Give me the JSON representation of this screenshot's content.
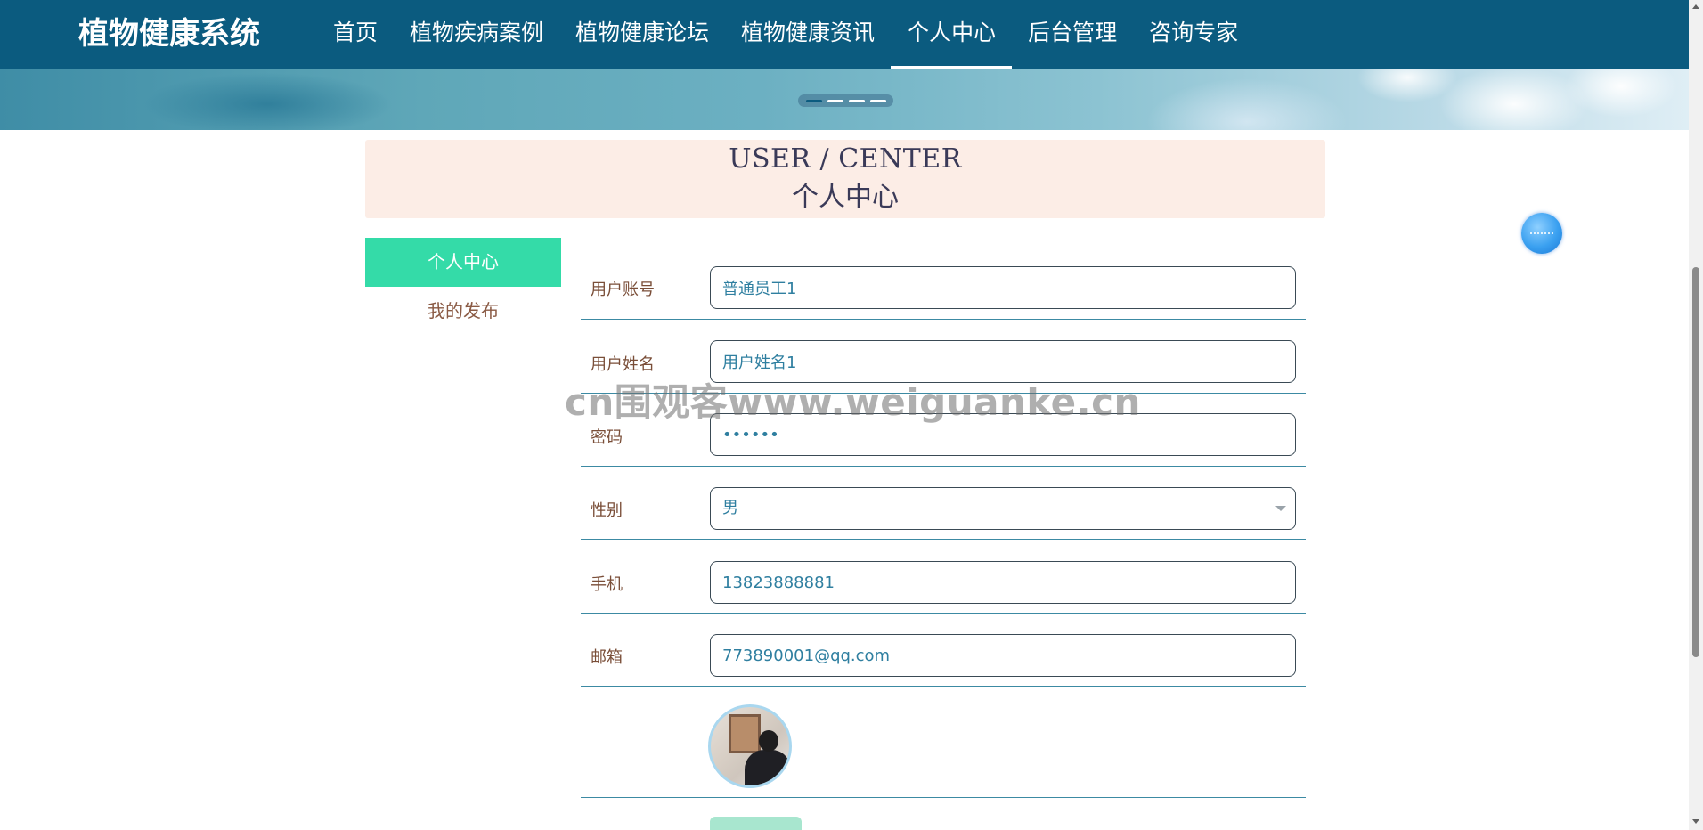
{
  "header": {
    "brand": "植物健康系统",
    "nav": [
      {
        "label": "首页"
      },
      {
        "label": "植物疾病案例"
      },
      {
        "label": "植物健康论坛"
      },
      {
        "label": "植物健康资讯"
      },
      {
        "label": "个人中心",
        "active": true
      },
      {
        "label": "后台管理"
      },
      {
        "label": "咨询专家"
      }
    ]
  },
  "banner": {
    "dot_count": 4,
    "active_dot": 1
  },
  "center_header": {
    "title_en": "USER / CENTER",
    "title_cn": "个人中心"
  },
  "sidebar": {
    "items": [
      {
        "label": "个人中心",
        "active": true
      },
      {
        "label": "我的发布"
      }
    ]
  },
  "form": {
    "account": {
      "label": "用户账号",
      "value": "普通员工1"
    },
    "name": {
      "label": "用户姓名",
      "value": "用户姓名1"
    },
    "password": {
      "label": "密码",
      "value": "••••••"
    },
    "gender": {
      "label": "性别",
      "value": "男"
    },
    "phone": {
      "label": "手机",
      "value": "13823888881"
    },
    "email": {
      "label": "邮箱",
      "value": "773890001@qq.com"
    }
  },
  "watermark": {
    "text": "cn围观客www.weiguanke.cn"
  },
  "colors": {
    "nav_bg": "#0b5b7f",
    "accent_green": "#34dba8",
    "label_brown": "#7a4e38",
    "input_text": "#2f7fa0",
    "header_bg": "#fcede6"
  }
}
